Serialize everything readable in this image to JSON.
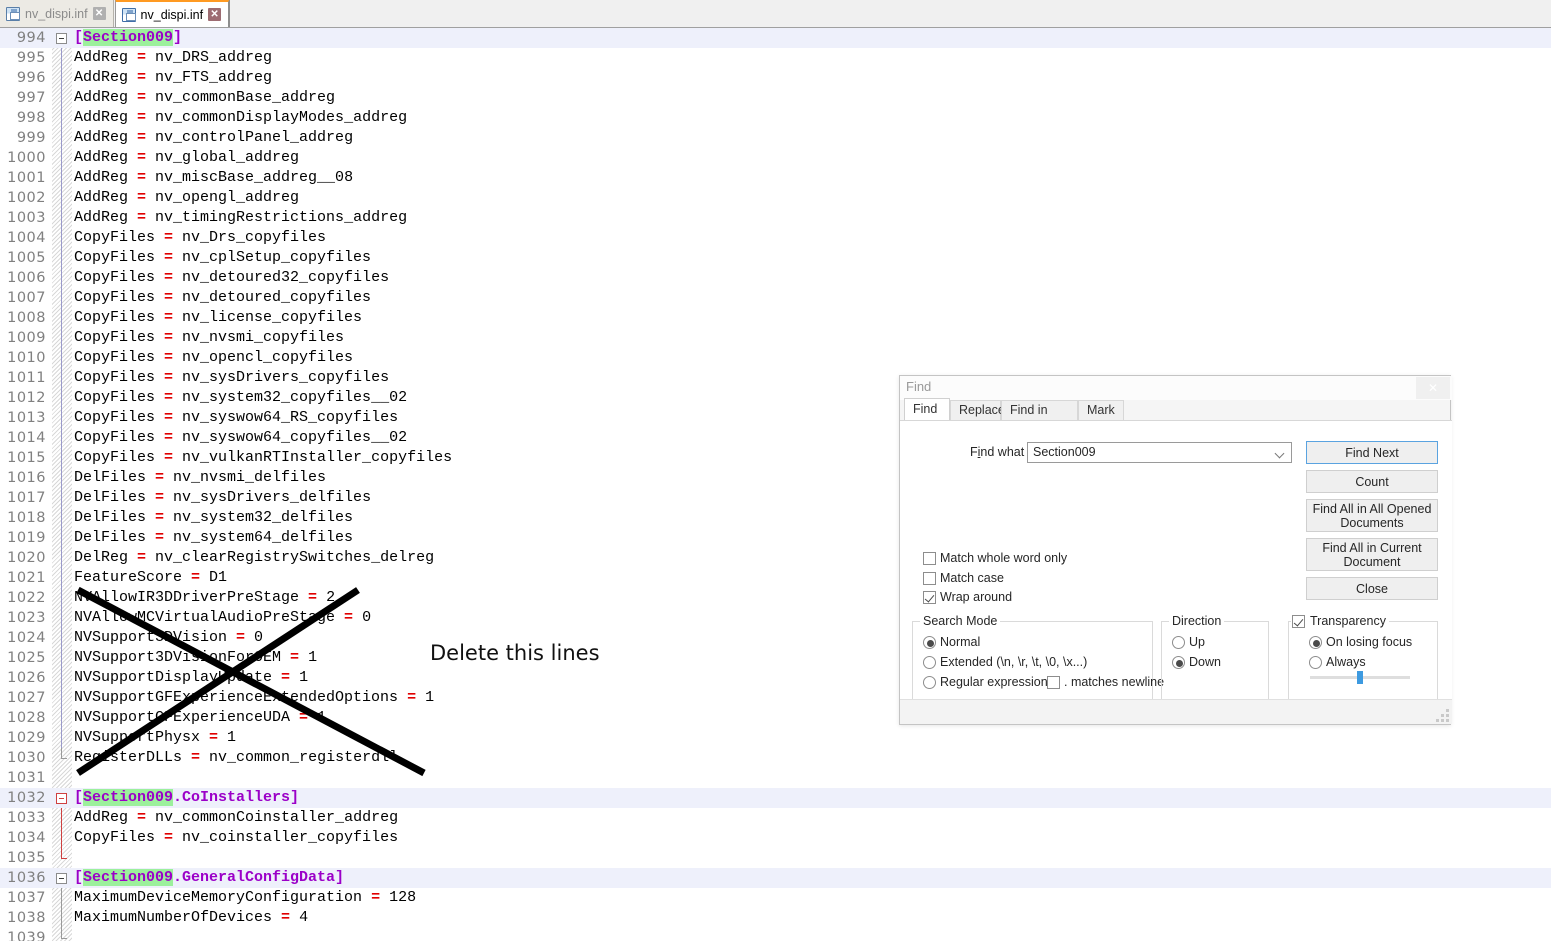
{
  "tabs": [
    {
      "label": "nv_dispi.inf",
      "active": false
    },
    {
      "label": "nv_dispi.inf",
      "active": true
    }
  ],
  "annotation": {
    "text": "Delete this lines"
  },
  "editor": {
    "first_line": 994,
    "lines": [
      {
        "n": 994,
        "type": "section",
        "text": "[Section009]",
        "fold": "open-purple",
        "hl": true,
        "mark": "Section009"
      },
      {
        "n": 995,
        "type": "kv",
        "key": "AddReg",
        "val": "nv_DRS_addreg"
      },
      {
        "n": 996,
        "type": "kv",
        "key": "AddReg",
        "val": "nv_FTS_addreg"
      },
      {
        "n": 997,
        "type": "kv",
        "key": "AddReg",
        "val": "nv_commonBase_addreg"
      },
      {
        "n": 998,
        "type": "kv",
        "key": "AddReg",
        "val": "nv_commonDisplayModes_addreg"
      },
      {
        "n": 999,
        "type": "kv",
        "key": "AddReg",
        "val": "nv_controlPanel_addreg"
      },
      {
        "n": 1000,
        "type": "kv",
        "key": "AddReg",
        "val": "nv_global_addreg"
      },
      {
        "n": 1001,
        "type": "kv",
        "key": "AddReg",
        "val": "nv_miscBase_addreg__08"
      },
      {
        "n": 1002,
        "type": "kv",
        "key": "AddReg",
        "val": "nv_opengl_addreg"
      },
      {
        "n": 1003,
        "type": "kv",
        "key": "AddReg",
        "val": "nv_timingRestrictions_addreg"
      },
      {
        "n": 1004,
        "type": "kv",
        "key": "CopyFiles",
        "val": "nv_Drs_copyfiles"
      },
      {
        "n": 1005,
        "type": "kv",
        "key": "CopyFiles",
        "val": "nv_cplSetup_copyfiles"
      },
      {
        "n": 1006,
        "type": "kv",
        "key": "CopyFiles",
        "val": "nv_detoured32_copyfiles"
      },
      {
        "n": 1007,
        "type": "kv",
        "key": "CopyFiles",
        "val": "nv_detoured_copyfiles"
      },
      {
        "n": 1008,
        "type": "kv",
        "key": "CopyFiles",
        "val": "nv_license_copyfiles"
      },
      {
        "n": 1009,
        "type": "kv",
        "key": "CopyFiles",
        "val": "nv_nvsmi_copyfiles"
      },
      {
        "n": 1010,
        "type": "kv",
        "key": "CopyFiles",
        "val": "nv_opencl_copyfiles"
      },
      {
        "n": 1011,
        "type": "kv",
        "key": "CopyFiles",
        "val": "nv_sysDrivers_copyfiles"
      },
      {
        "n": 1012,
        "type": "kv",
        "key": "CopyFiles",
        "val": "nv_system32_copyfiles__02"
      },
      {
        "n": 1013,
        "type": "kv",
        "key": "CopyFiles",
        "val": "nv_syswow64_RS_copyfiles"
      },
      {
        "n": 1014,
        "type": "kv",
        "key": "CopyFiles",
        "val": "nv_syswow64_copyfiles__02"
      },
      {
        "n": 1015,
        "type": "kv",
        "key": "CopyFiles",
        "val": "nv_vulkanRTInstaller_copyfiles"
      },
      {
        "n": 1016,
        "type": "kv",
        "key": "DelFiles",
        "val": "nv_nvsmi_delfiles"
      },
      {
        "n": 1017,
        "type": "kv",
        "key": "DelFiles",
        "val": "nv_sysDrivers_delfiles"
      },
      {
        "n": 1018,
        "type": "kv",
        "key": "DelFiles",
        "val": "nv_system32_delfiles"
      },
      {
        "n": 1019,
        "type": "kv",
        "key": "DelFiles",
        "val": "nv_system64_delfiles"
      },
      {
        "n": 1020,
        "type": "kv",
        "key": "DelReg",
        "val": "nv_clearRegistrySwitches_delreg"
      },
      {
        "n": 1021,
        "type": "kv",
        "key": "FeatureScore",
        "val": "D1"
      },
      {
        "n": 1022,
        "type": "kv",
        "key": "NVAllowIR3DDriverPreStage",
        "val": "2"
      },
      {
        "n": 1023,
        "type": "kv",
        "key": "NVAllowMCVirtualAudioPreStage",
        "val": "0"
      },
      {
        "n": 1024,
        "type": "kv",
        "key": "NVSupport3DVision",
        "val": "0"
      },
      {
        "n": 1025,
        "type": "kv",
        "key": "NVSupport3DVisionForOEM",
        "val": "1"
      },
      {
        "n": 1026,
        "type": "kv",
        "key": "NVSupportDisplayUpdate",
        "val": "1"
      },
      {
        "n": 1027,
        "type": "kv",
        "key": "NVSupportGFExperienceExtendedOptions",
        "val": "1"
      },
      {
        "n": 1028,
        "type": "kv",
        "key": "NVSupportGFExperienceUDA",
        "val": "1"
      },
      {
        "n": 1029,
        "type": "kv",
        "key": "NVSupportPhysx",
        "val": "1"
      },
      {
        "n": 1030,
        "type": "kv",
        "key": "RegisterDLLs",
        "val": "nv_common_registerdll",
        "foldend": "gray"
      },
      {
        "n": 1031,
        "type": "blank"
      },
      {
        "n": 1032,
        "type": "section",
        "text": "[Section009.CoInstallers]",
        "fold": "open-red",
        "hl": true,
        "mark": "Section009"
      },
      {
        "n": 1033,
        "type": "kv",
        "key": "AddReg",
        "val": "nv_commonCoinstaller_addreg",
        "foldbar": "red"
      },
      {
        "n": 1034,
        "type": "kv",
        "key": "CopyFiles",
        "val": "nv_coinstaller_copyfiles",
        "foldbar": "red"
      },
      {
        "n": 1035,
        "type": "blank",
        "foldend": "red"
      },
      {
        "n": 1036,
        "type": "section",
        "text": "[Section009.GeneralConfigData]",
        "fold": "open-gray",
        "hl": true,
        "mark": "Section009"
      },
      {
        "n": 1037,
        "type": "kv",
        "key": "MaximumDeviceMemoryConfiguration",
        "val": "128",
        "foldbar": "gray"
      },
      {
        "n": 1038,
        "type": "kv",
        "key": "MaximumNumberOfDevices",
        "val": "4",
        "foldbar": "gray"
      },
      {
        "n": 1039,
        "type": "blank",
        "foldend": "gray"
      }
    ]
  },
  "find_dialog": {
    "title": "Find",
    "close_icon": "✕",
    "tabs": [
      {
        "label": "Find",
        "selected": true
      },
      {
        "label": "Replace",
        "selected": false
      },
      {
        "label": "Find in Files",
        "selected": false
      },
      {
        "label": "Mark",
        "selected": false
      }
    ],
    "find_what": {
      "label_pre": "F",
      "label_accel": "i",
      "label_post": "nd what :",
      "value": "Section009",
      "dropdown_icon": "chevron-down"
    },
    "buttons": [
      {
        "name": "find-next",
        "text": "Find Next",
        "focused": true
      },
      {
        "name": "count",
        "text": "Count",
        "focused": false
      },
      {
        "name": "find-all-opened",
        "text": "Find All in All Opened Documents",
        "focused": false
      },
      {
        "name": "find-all-current",
        "text": "Find All in Current Document",
        "focused": false
      },
      {
        "name": "close",
        "text": "Close",
        "focused": false
      }
    ],
    "checkboxes": [
      {
        "name": "match-whole-word",
        "text": "Match whole word only",
        "checked": false
      },
      {
        "name": "match-case",
        "text": "Match case",
        "checked": false
      },
      {
        "name": "wrap-around",
        "text": "Wrap around",
        "checked": true
      }
    ],
    "search_mode": {
      "legend": "Search Mode",
      "options": [
        {
          "text": "Normal",
          "selected": true
        },
        {
          "text": "Extended (\\n, \\r, \\t, \\0, \\x...)",
          "selected": false
        },
        {
          "text": "Regular expression",
          "selected": false
        }
      ],
      "matches_newline": {
        "text": ". matches newline",
        "checked": false
      }
    },
    "direction": {
      "legend": "Direction",
      "options": [
        {
          "text": "Up",
          "selected": false
        },
        {
          "text": "Down",
          "selected": true
        }
      ]
    },
    "transparency": {
      "legend": "Transparency",
      "checked": true,
      "options": [
        {
          "text": "On losing focus",
          "selected": true
        },
        {
          "text": "Always",
          "selected": false
        }
      ],
      "slider_percent": 47
    }
  },
  "colors": {
    "section_text": "#9b00c8",
    "mark_highlight": "#9cf09c",
    "operator": "#e00000",
    "active_tab_accent": "#ff9a22",
    "focus_border": "#5aa3e0",
    "slider_thumb": "#3d9ae0",
    "line_number": "#808080",
    "current_line_bg": "#eef0fb"
  }
}
